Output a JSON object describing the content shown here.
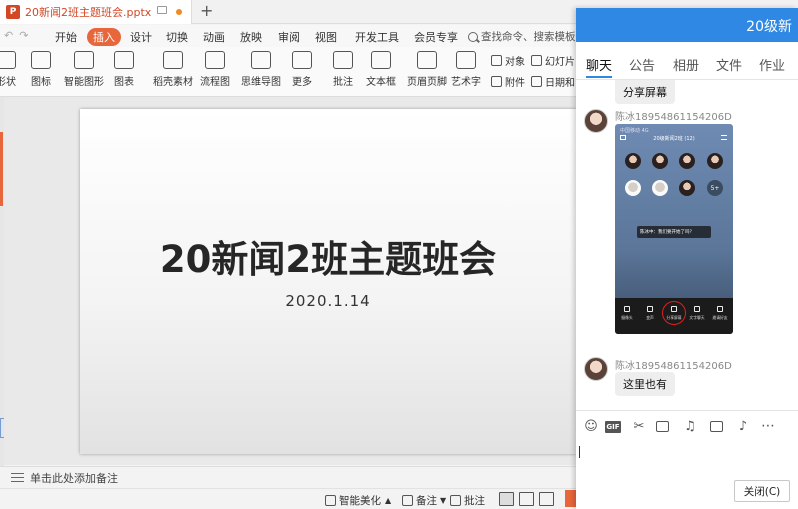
{
  "titlebar": {
    "doc_name": "20新闻2班主题班会.pptx",
    "logo_letter": "P",
    "new_tab": "+"
  },
  "menu": {
    "items": [
      "开始",
      "插入",
      "设计",
      "切换",
      "动画",
      "放映",
      "审阅",
      "视图",
      "开发工具",
      "会员专享"
    ],
    "active_index": 1,
    "search_placeholder": "查找命令、搜索模板"
  },
  "ribbon": {
    "items": [
      "形状",
      "图标",
      "智能图形",
      "图表",
      "稻壳素材",
      "流程图",
      "思维导图",
      "更多",
      "批注",
      "文本框",
      "页眉页脚",
      "艺术字"
    ],
    "small": [
      "对象",
      "幻灯片",
      "附件",
      "日期和"
    ]
  },
  "slide": {
    "title": "20新闻2班主题班会",
    "date": "2020.1.14"
  },
  "notes": {
    "placeholder": "单击此处添加备注"
  },
  "status": {
    "beautify": "智能美化",
    "notes": "备注",
    "comments": "批注"
  },
  "chat": {
    "title": "20级新",
    "tabs": [
      "聊天",
      "公告",
      "相册",
      "文件",
      "作业"
    ],
    "active_tab": 0,
    "messages": {
      "first_bubble": "分享屏幕",
      "sender": "陈冰18954861154206D",
      "last_bubble": "这里也有"
    },
    "phone": {
      "status": "中国移动 4G",
      "room": "20级新闻2班 (12)",
      "more": "5+",
      "toast": "陈冰中：我们要开始了吗？",
      "buttons": [
        "摄像头",
        "变声",
        "分享屏幕",
        "文字聊天",
        "邀请好友"
      ]
    },
    "close_label": "关闭(C)"
  },
  "colors": {
    "accent": "#e8663c",
    "chat_blue": "#2f88e3"
  }
}
